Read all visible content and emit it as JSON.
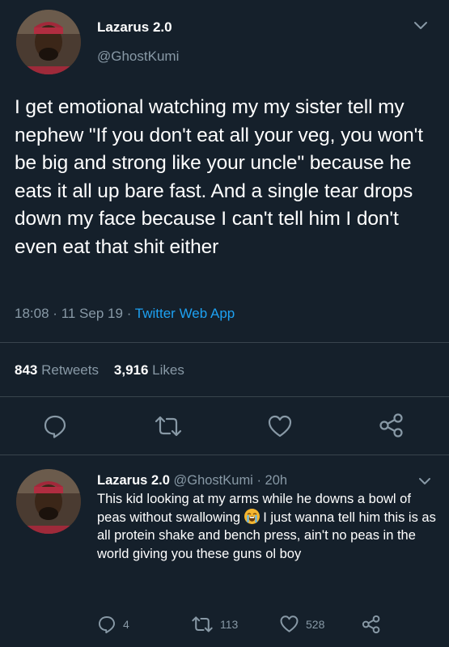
{
  "tweet": {
    "author_name": "Lazarus 2.0",
    "author_handle": "@GhostKumi",
    "text": "I get emotional watching my my sister tell my nephew \"If you don't eat all your veg, you won't be big and strong like your uncle\" because he eats it all up bare fast. And a single tear drops down my face because I can't tell him I don't even eat that shit either",
    "time": "18:08",
    "date": "11 Sep 19",
    "separator": "·",
    "source": "Twitter Web App",
    "retweets_count": "843",
    "retweets_label": "Retweets",
    "likes_count": "3,916",
    "likes_label": "Likes"
  },
  "reply": {
    "author_name": "Lazarus 2.0",
    "author_handle": "@GhostKumi",
    "separator": "·",
    "age": "20h",
    "text_before_emoji": "This kid looking at my arms while he downs a bowl of peas without swallowing",
    "emoji": "loudly-crying-face",
    "text_after_emoji": " I just wanna tell him this is as all protein shake and bench press, ain't no peas in the world giving you these guns ol boy",
    "replies_count": "4",
    "retweets_count": "113",
    "likes_count": "528"
  },
  "colors": {
    "background": "#15202b",
    "text": "#ffffff",
    "muted": "#8899a6",
    "link": "#1da1f2",
    "divider": "#38444d"
  },
  "icons": [
    "chevron-down-icon",
    "reply-icon",
    "retweet-icon",
    "like-icon",
    "share-icon"
  ]
}
